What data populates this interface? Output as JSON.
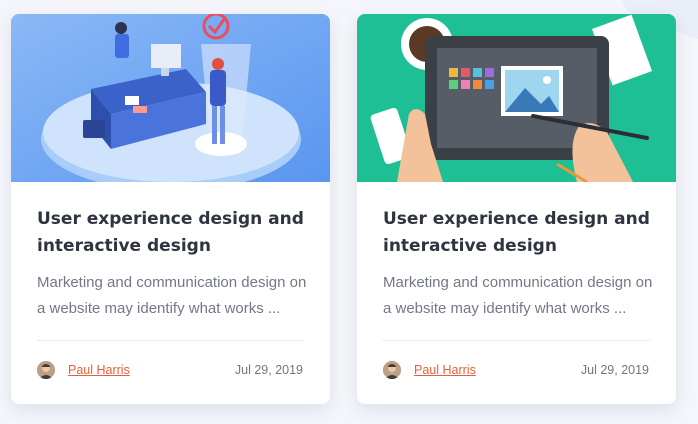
{
  "cards": [
    {
      "title": "User experience design and interactive design",
      "excerpt": "Marketing and communication design on a website may identify what works ...",
      "author": "Paul Harris",
      "date": "Jul 29, 2019",
      "image_icon": "office-desk-illustration"
    },
    {
      "title": "User experience design and interactive design",
      "excerpt": "Marketing and communication design on a website may identify what works ...",
      "author": "Paul Harris",
      "date": "Jul 29, 2019",
      "image_icon": "tablet-drawing-illustration"
    }
  ],
  "colors": {
    "author_link": "#e2603f",
    "title": "#2f3441",
    "card1_bg": "#6fa8f5",
    "card2_bg": "#1fbf95"
  }
}
